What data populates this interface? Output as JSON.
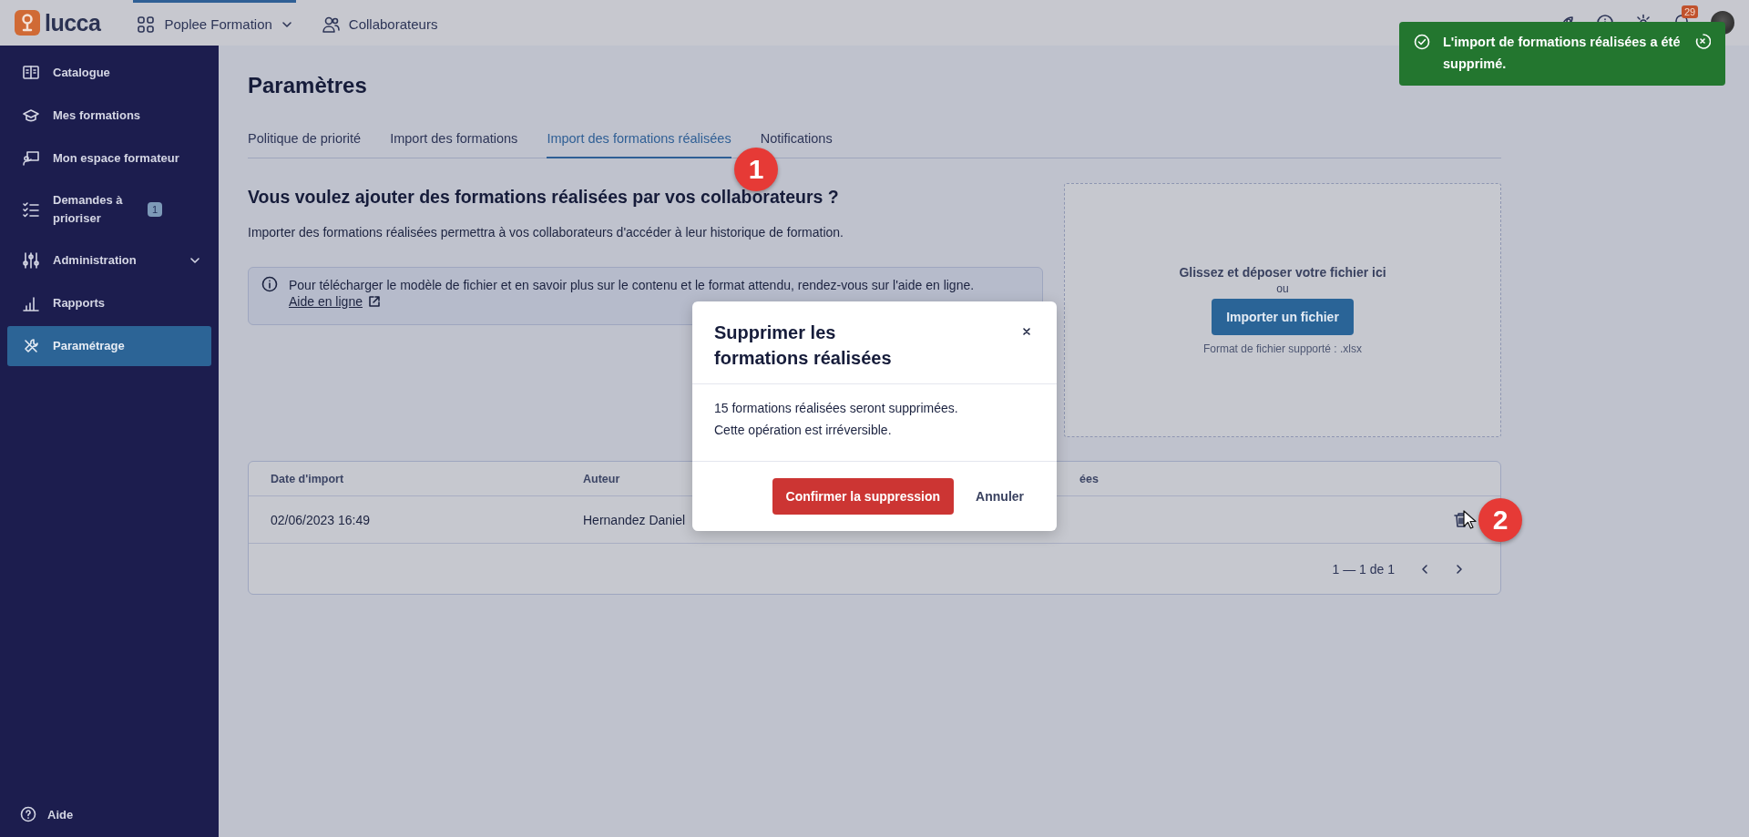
{
  "header": {
    "logo": "lucca",
    "app": {
      "label": "Poplee Formation",
      "selected": true
    },
    "nav": {
      "label": "Collaborateurs",
      "selected": false
    },
    "notification_count": "29"
  },
  "sidebar": {
    "items": [
      {
        "label": "Catalogue",
        "selected": false
      },
      {
        "label": "Mes formations",
        "selected": false
      },
      {
        "label": "Mon espace formateur",
        "selected": false
      },
      {
        "label": "Demandes à prioriser",
        "badge": "1",
        "selected": false
      },
      {
        "label": "Administration",
        "expanded": false,
        "selected": false
      },
      {
        "label": "Rapports",
        "selected": false
      },
      {
        "label": "Paramétrage",
        "selected": true
      }
    ],
    "help": "Aide"
  },
  "page": {
    "title": "Paramètres",
    "tabs": [
      {
        "label": "Politique de priorité",
        "selected": false
      },
      {
        "label": "Import des formations",
        "selected": false
      },
      {
        "label": "Import des formations réalisées",
        "selected": true
      },
      {
        "label": "Notifications",
        "selected": false
      }
    ],
    "heading": "Vous voulez ajouter des formations réalisées par vos collaborateurs ?",
    "description": "Importer des formations réalisées permettra à vos collaborateurs d'accéder à leur historique de formation.",
    "info": {
      "text": "Pour télécharger le modèle de fichier et en savoir plus sur le contenu et le format attendu, rendez-vous sur l'aide en ligne.",
      "link": "Aide en ligne"
    },
    "dropzone": {
      "title": "Glissez et déposer votre fichier ici",
      "or": "ou",
      "button": "Importer un fichier",
      "hint": "Format de fichier supporté : .xlsx"
    },
    "table": {
      "columns": [
        {
          "label": "Date d'import"
        },
        {
          "label": "Auteur"
        },
        {
          "label": "ées"
        }
      ],
      "rows": [
        {
          "cells": [
            "02/06/2023 16:49",
            "Hernandez Daniel"
          ]
        }
      ],
      "pagination": "1 — 1 de 1"
    }
  },
  "modal": {
    "title": "Supprimer les formations réalisées",
    "lines": [
      "15 formations réalisées seront supprimées.",
      "Cette opération est irréversible."
    ],
    "confirm": "Confirmer la suppression",
    "cancel": "Annuler"
  },
  "toast": {
    "message": "L'import de formations réalisées a été supprimé."
  },
  "annotations": [
    "1",
    "2"
  ]
}
